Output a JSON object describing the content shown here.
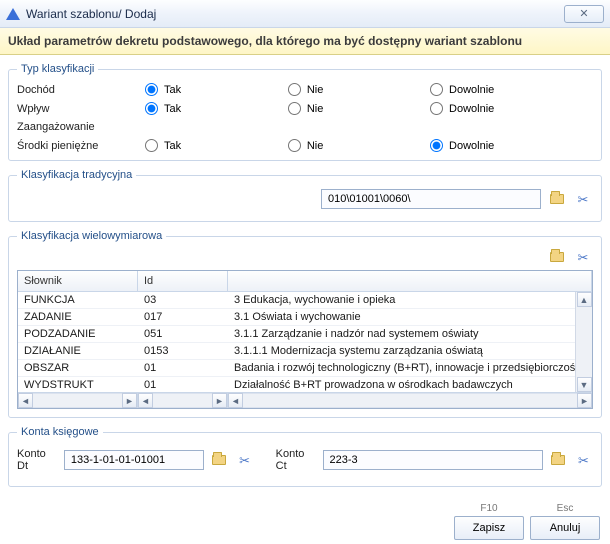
{
  "window": {
    "title": "Wariant szablonu/ Dodaj",
    "close": "✕"
  },
  "header": "Układ parametrów dekretu podstawowego, dla którego ma być dostępny wariant szablonu",
  "typk": {
    "legend": "Typ klasyfikacji",
    "options": {
      "tak": "Tak",
      "nie": "Nie",
      "dow": "Dowolnie"
    },
    "rows": {
      "dochod": "Dochód",
      "wplyw": "Wpływ",
      "zaang": "Zaangażowanie",
      "srodki": "Środki pieniężne"
    },
    "selected": {
      "dochod": "tak",
      "wplyw": "tak",
      "srodki": "dow"
    }
  },
  "trad": {
    "legend": "Klasyfikacja tradycyjna",
    "value": "010\\01001\\0060\\"
  },
  "mw": {
    "legend": "Klasyfikacja wielowymiarowa",
    "headers": {
      "slownik": "Słownik",
      "id": "Id",
      "desc": ""
    },
    "rows": [
      {
        "s": "FUNKCJA",
        "i": "03",
        "d": "3 Edukacja, wychowanie i opieka"
      },
      {
        "s": "ZADANIE",
        "i": "017",
        "d": "3.1 Oświata i wychowanie"
      },
      {
        "s": "PODZADANIE",
        "i": "051",
        "d": "3.1.1 Zarządzanie i nadzór nad systemem oświaty"
      },
      {
        "s": "DZIAŁANIE",
        "i": "0153",
        "d": "3.1.1.1 Modernizacja systemu zarządzania oświatą"
      },
      {
        "s": "OBSZAR",
        "i": "01",
        "d": "Badania i rozwój technologiczny (B+RT), innowacje i przedsiębiorczość"
      },
      {
        "s": "WYDSTRUKT",
        "i": "01",
        "d": "Działalność B+RT prowadzona w ośrodkach badawczych"
      }
    ]
  },
  "konta": {
    "legend": "Konta księgowe",
    "dt_label": "Konto Dt",
    "dt_value": "133-1-01-01-01001",
    "ct_label": "Konto Ct",
    "ct_value": "223-3"
  },
  "footer": {
    "save_hint": "F10",
    "save": "Zapisz",
    "cancel_hint": "Esc",
    "cancel": "Anuluj"
  }
}
